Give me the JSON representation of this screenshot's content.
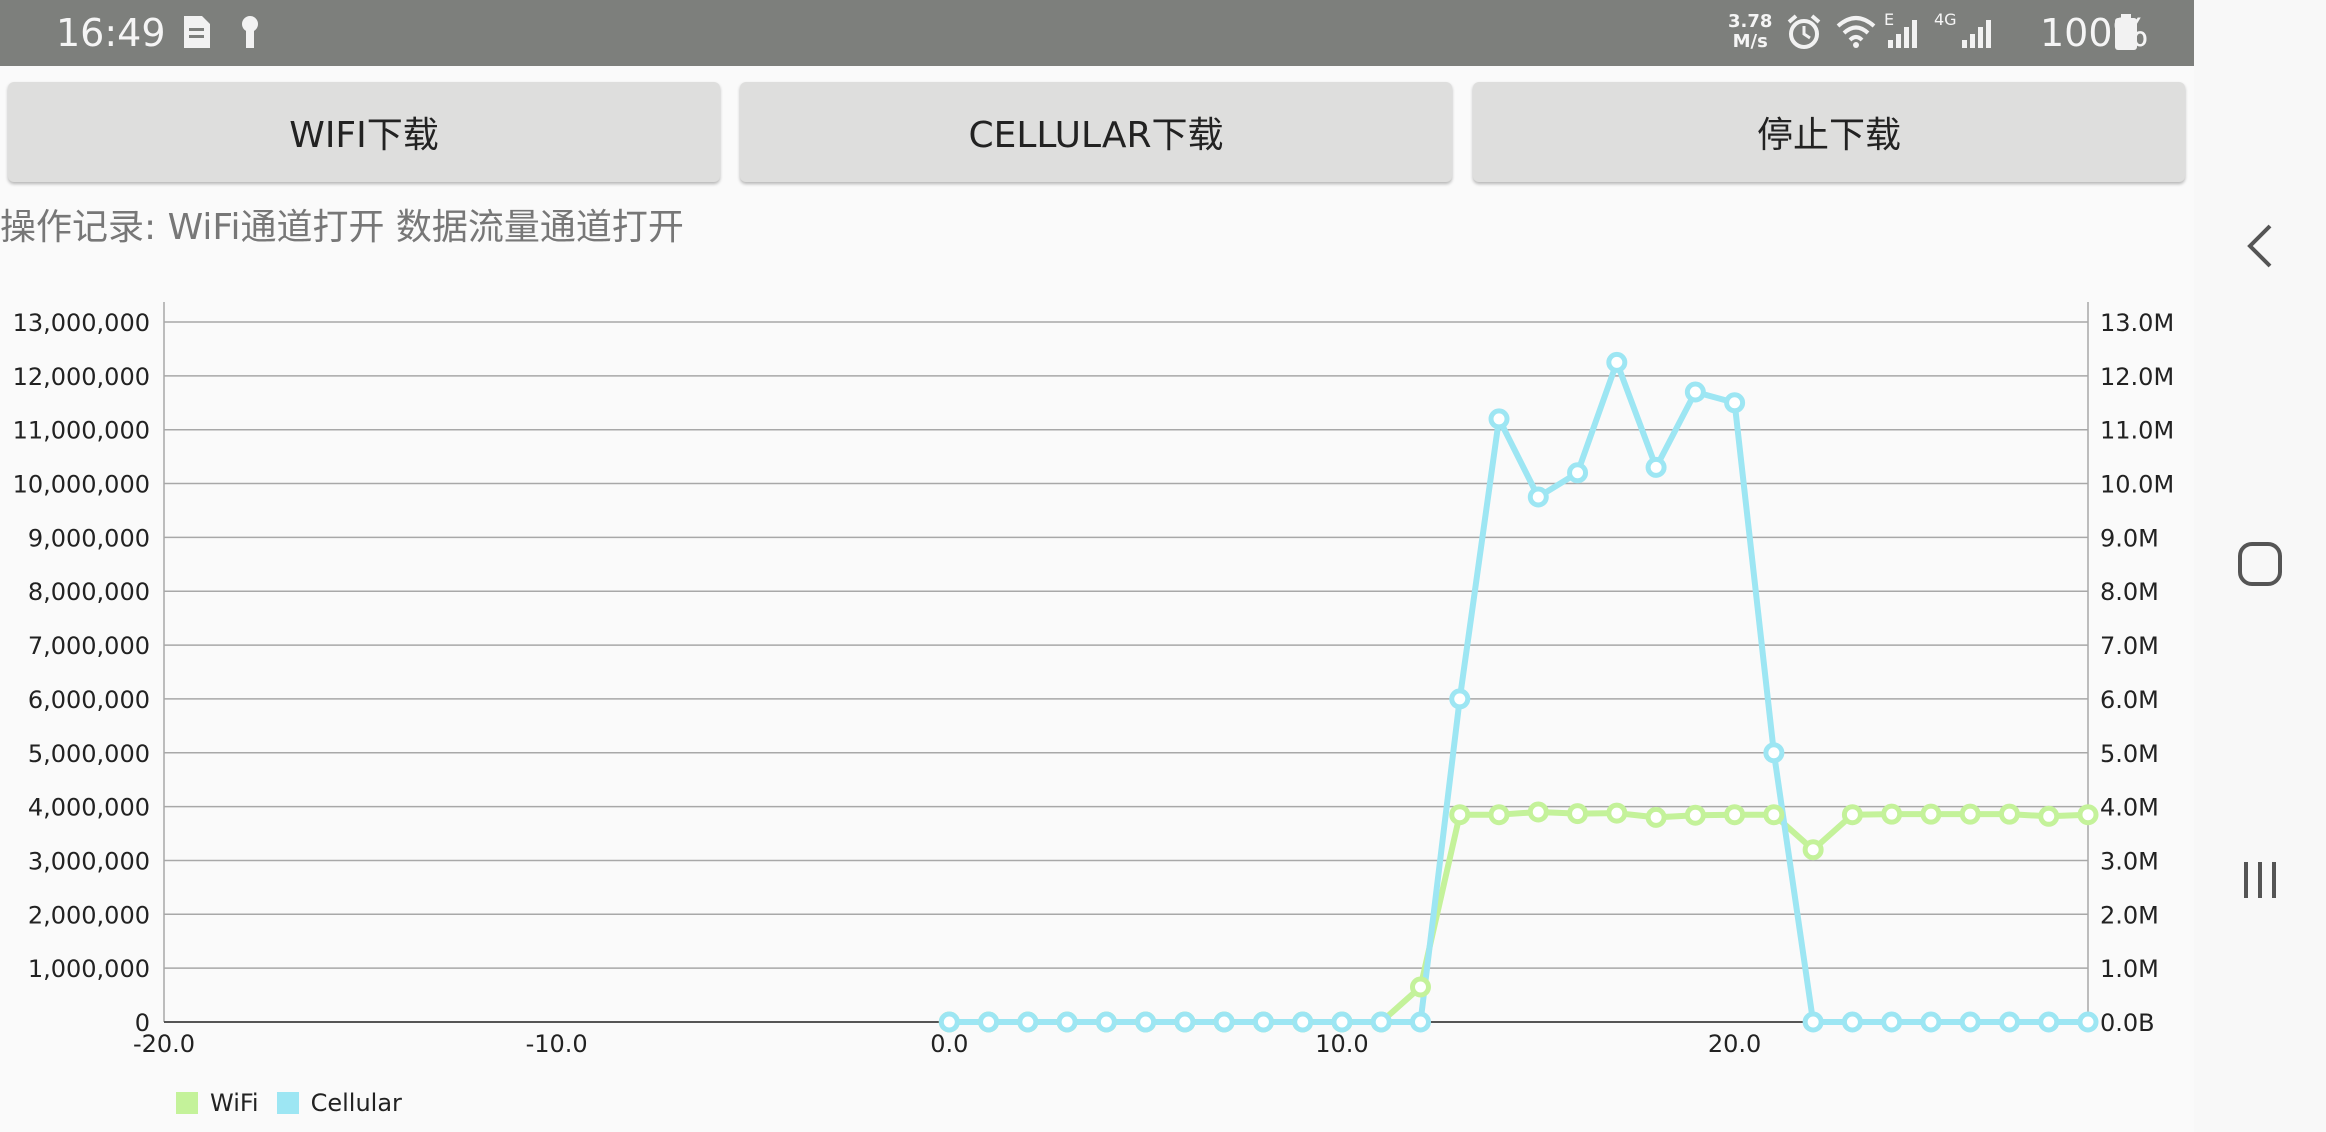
{
  "status_bar": {
    "time": "16:49",
    "speed_value": "3.78",
    "speed_unit": "M/s",
    "network_type_1": "E",
    "network_type_2": "4G",
    "battery": "100%",
    "icons": [
      "sim-card-icon",
      "key-icon",
      "alarm-icon",
      "wifi-icon",
      "signal-icon",
      "signal-icon",
      "battery-icon"
    ]
  },
  "buttons": {
    "wifi_download": "WIFI下载",
    "cellular_download": "CELLULAR下载",
    "stop_download": "停止下载"
  },
  "log": {
    "text": "操作记录: WiFi通道打开 数据流量通道打开"
  },
  "nav": {
    "icons": [
      "back-icon",
      "home-icon",
      "recents-icon"
    ]
  },
  "colors": {
    "wifi": "#c4f29a",
    "cellular": "#9de6f3",
    "grid": "#a8a8a8",
    "axis_text": "#222222"
  },
  "chart_data": {
    "type": "line",
    "xlim": [
      -20,
      29
    ],
    "ylim": [
      0,
      13000000
    ],
    "x_ticks": [
      "-20.0",
      "-10.0",
      "0.0",
      "10.0",
      "20.0"
    ],
    "x_tick_values": [
      -20,
      -10,
      0,
      10,
      20
    ],
    "y_ticks_left": [
      "0",
      "1,000,000",
      "2,000,000",
      "3,000,000",
      "4,000,000",
      "5,000,000",
      "6,000,000",
      "7,000,000",
      "8,000,000",
      "9,000,000",
      "10,000,000",
      "11,000,000",
      "12,000,000",
      "13,000,000"
    ],
    "y_ticks_right": [
      "0.0B",
      "1.0M",
      "2.0M",
      "3.0M",
      "4.0M",
      "5.0M",
      "6.0M",
      "7.0M",
      "8.0M",
      "9.0M",
      "10.0M",
      "11.0M",
      "12.0M",
      "13.0M"
    ],
    "y_tick_values": [
      0,
      1000000,
      2000000,
      3000000,
      4000000,
      5000000,
      6000000,
      7000000,
      8000000,
      9000000,
      10000000,
      11000000,
      12000000,
      13000000
    ],
    "grid": true,
    "legend_position": "bottom-left",
    "x": [
      0,
      1,
      2,
      3,
      4,
      5,
      6,
      7,
      8,
      9,
      10,
      11,
      12,
      13,
      14,
      15,
      16,
      17,
      18,
      19,
      20,
      21,
      22,
      23,
      24,
      25,
      26,
      27,
      28,
      29
    ],
    "series": [
      {
        "name": "WiFi",
        "values": [
          0,
          0,
          0,
          0,
          0,
          0,
          0,
          0,
          0,
          0,
          0,
          0,
          650000,
          3850000,
          3850000,
          3900000,
          3870000,
          3880000,
          3800000,
          3840000,
          3850000,
          3850000,
          3200000,
          3850000,
          3860000,
          3860000,
          3860000,
          3860000,
          3820000,
          3850000
        ]
      },
      {
        "name": "Cellular",
        "values": [
          0,
          0,
          0,
          0,
          0,
          0,
          0,
          0,
          0,
          0,
          0,
          0,
          0,
          6000000,
          11200000,
          9750000,
          10200000,
          12250000,
          10300000,
          11700000,
          11500000,
          5000000,
          0,
          0,
          0,
          0,
          0,
          0,
          0,
          0
        ]
      }
    ]
  }
}
